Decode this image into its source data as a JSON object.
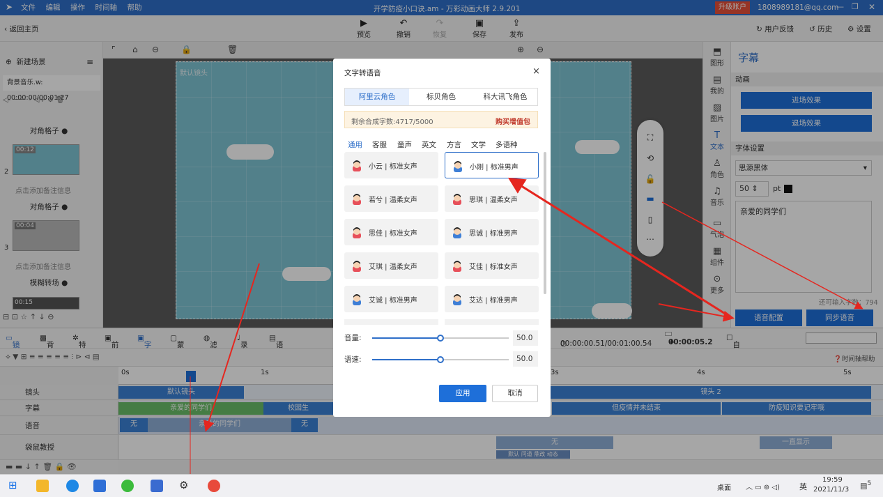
{
  "titlebar": {
    "menu": [
      "文件",
      "编辑",
      "操作",
      "时间轴",
      "帮助"
    ],
    "title": "开学防疫小口诀.am - 万彩动画大师 2.9.201",
    "upgrade": "升级账户",
    "account": "1808989181@qq.com"
  },
  "toolbar": {
    "back": "返回主页",
    "preview": "预览",
    "undo": "撤销",
    "redo": "恢复",
    "save": "保存",
    "publish": "发布",
    "feedback": "用户反馈",
    "history": "历史",
    "settings": "设置"
  },
  "left": {
    "new_scene": "新建场景",
    "bgm": "背景音乐.w: 00:00:00/00:01:27",
    "transition1": "对角格子",
    "scene2_time": "00:12",
    "scene2_num": "2",
    "note_hint": "点击添加备注信息",
    "transition2": "对角格子",
    "scene3_time": "00:04",
    "scene3_num": "3",
    "transition3": "模糊转场",
    "scene4_time": "00:15"
  },
  "canvas": {
    "camera_label": "默认镜头"
  },
  "right_icons": [
    "图形",
    "我的",
    "图片",
    "文本",
    "角色",
    "音乐",
    "气泡",
    "组件",
    "更多"
  ],
  "right_panel": {
    "title": "字幕",
    "anim_section": "动画",
    "enter": "进场效果",
    "exit": "退场效果",
    "font_section": "字体设置",
    "font": "思源黑体",
    "size": "50",
    "pt": "pt",
    "text": "亲爱的同学们",
    "remaining": "还可输入字数：794",
    "voice_config": "语音配置",
    "sync_voice": "同步语音"
  },
  "timeline": {
    "tabs": [
      "镜头",
      "背景",
      "特效",
      "前景",
      "字幕",
      "蒙版",
      "滤镜",
      "录音",
      "语音合成"
    ],
    "time": "00:00:00.51/00:01:00.54",
    "step": "00:00:05.2",
    "auto_fit": "自动适应",
    "help": "时间轴帮助",
    "ruler": [
      "0s",
      "1s",
      "3s",
      "4s",
      "5s"
    ],
    "tracks": [
      "镜头",
      "字幕",
      "语音",
      "袋鼠教授"
    ],
    "clip_camera1": "默认镜头",
    "clip_camera2": "镜头 2",
    "clip_sub1": "亲爱的同学们",
    "clip_sub2": "校园生",
    "clip_sub3": "但疫情并未结束",
    "clip_sub4": "防疫知识要记牢哦",
    "clip_voice_none": "无",
    "clip_voice": "亲爱的同学们",
    "clip_voice_none2": "无",
    "clip_kangaroo_none": "无",
    "clip_kangaroo_show": "一直显示",
    "clip_kangaroo_small": "默认 问道 鼎改 动态"
  },
  "dialog": {
    "title": "文字转语音",
    "close": "×",
    "providers": [
      "阿里云角色",
      "标贝角色",
      "科大讯飞角色"
    ],
    "quota": "剩余合成字数:4717/5000",
    "buy": "购买增值包",
    "categories": [
      "通用",
      "客服",
      "童声",
      "英文",
      "方言",
      "文学",
      "多语种"
    ],
    "voices": [
      "小云 | 标准女声",
      "小刚 | 标准男声",
      "若兮 | 温柔女声",
      "思琪 | 温柔女声",
      "思佳 | 标准女声",
      "思诚 | 标准男声",
      "艾琪 | 温柔女声",
      "艾佳 | 标准女声",
      "艾诚 | 标准男声",
      "艾达 | 标准男声"
    ],
    "selected_voice": 1,
    "volume_label": "音量:",
    "volume": "50.0",
    "volume_level": 0.5,
    "speed_label": "语速:",
    "speed": "50.0",
    "speed_level": 0.5,
    "apply": "应用",
    "cancel": "取消"
  },
  "taskbar": {
    "desktop": "桌面",
    "lang": "英",
    "time": "19:59",
    "date": "2021/11/3",
    "notif": "5"
  }
}
